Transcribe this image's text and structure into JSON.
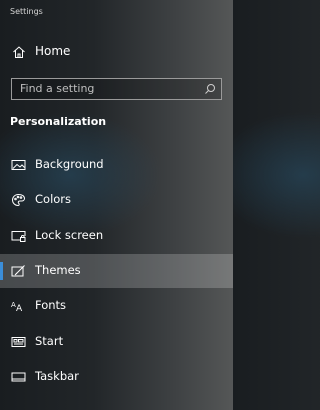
{
  "window": {
    "title": "Settings"
  },
  "home": {
    "label": "Home",
    "icon": "home-icon"
  },
  "search": {
    "placeholder": "Find a setting",
    "icon": "search-icon"
  },
  "section": {
    "title": "Personalization"
  },
  "nav": {
    "items": [
      {
        "label": "Background",
        "icon": "picture-icon",
        "selected": false
      },
      {
        "label": "Colors",
        "icon": "palette-icon",
        "selected": false
      },
      {
        "label": "Lock screen",
        "icon": "lock-screen-icon",
        "selected": false
      },
      {
        "label": "Themes",
        "icon": "brush-icon",
        "selected": true
      },
      {
        "label": "Fonts",
        "icon": "font-icon",
        "selected": false
      },
      {
        "label": "Start",
        "icon": "start-menu-icon",
        "selected": false
      },
      {
        "label": "Taskbar",
        "icon": "taskbar-icon",
        "selected": false
      }
    ]
  },
  "colors": {
    "accent": "#3b8ed9",
    "selected_bg": "rgba(255,255,255,0.20)"
  }
}
